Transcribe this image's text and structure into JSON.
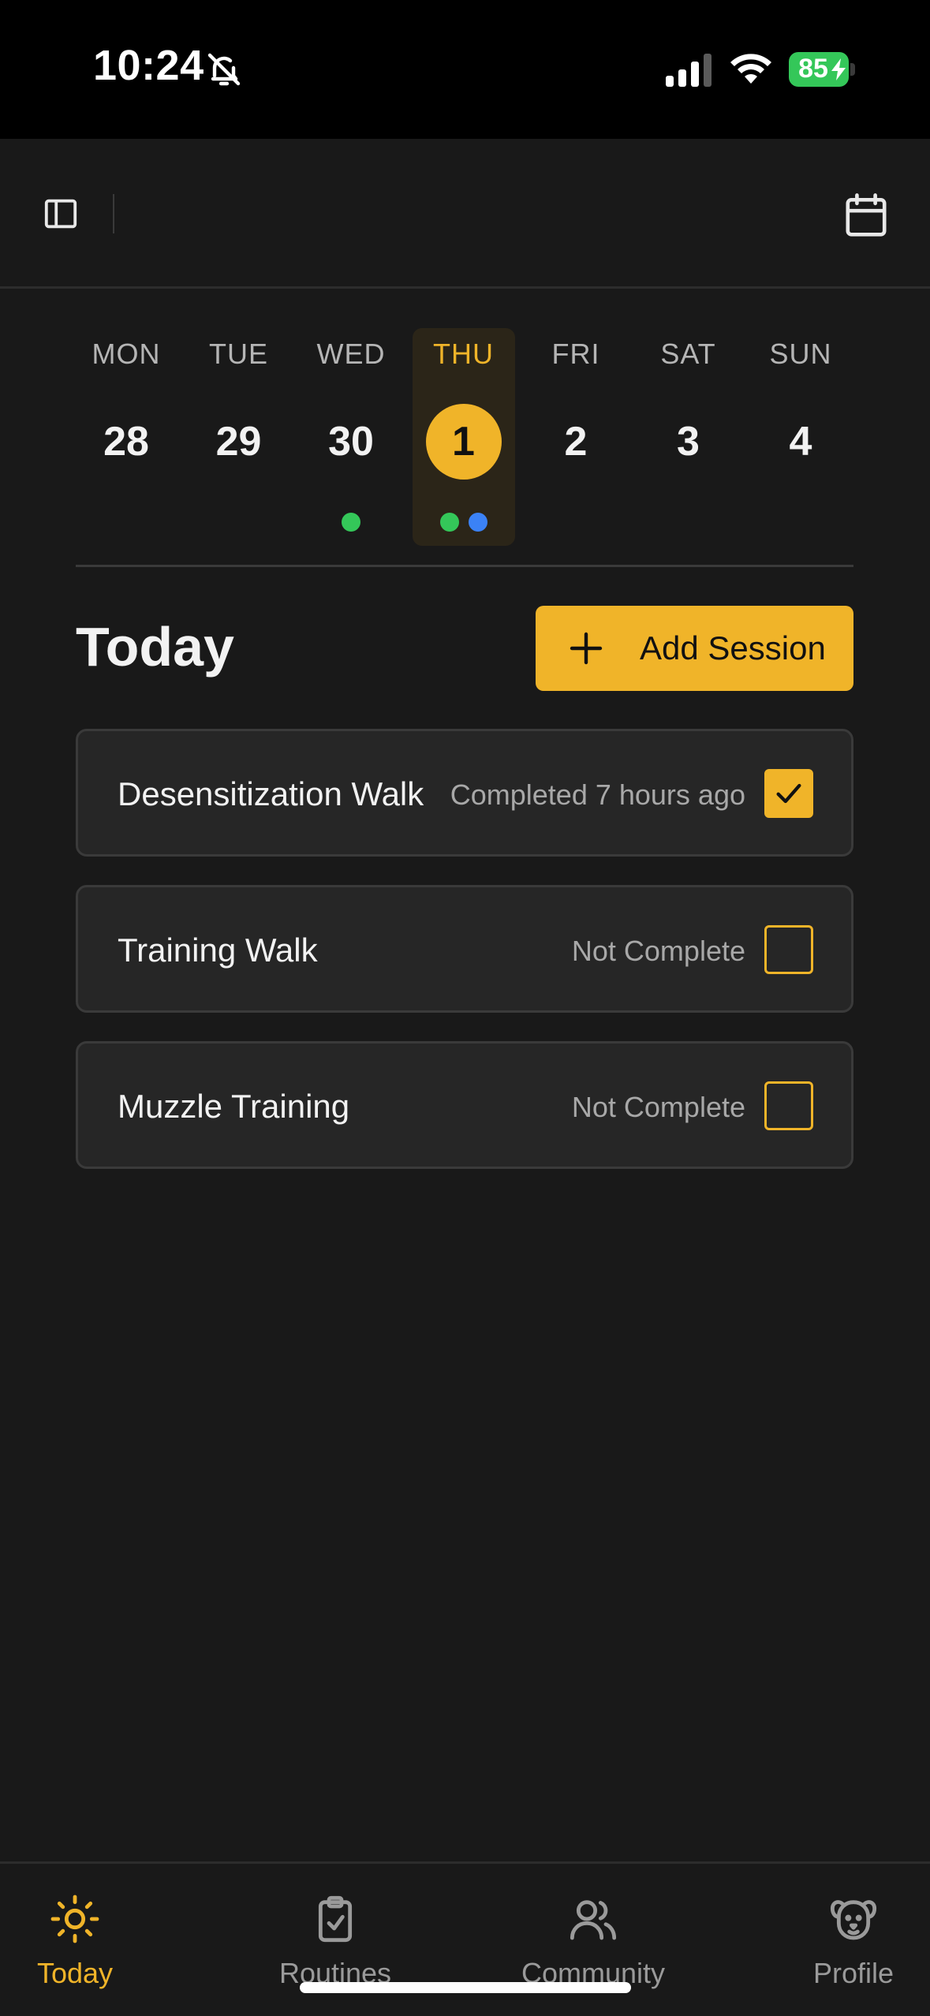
{
  "status_bar": {
    "time": "10:24",
    "battery": "85",
    "icons": [
      "bell-slash-icon",
      "signal-icon",
      "wifi-icon",
      "battery-charging-icon"
    ]
  },
  "top_nav": {
    "icons": [
      "sidebar-toggle-icon",
      "calendar-icon"
    ]
  },
  "week": [
    {
      "name": "MON",
      "num": "28",
      "dots": []
    },
    {
      "name": "TUE",
      "num": "29",
      "dots": []
    },
    {
      "name": "WED",
      "num": "30",
      "dots": [
        "#34c759"
      ]
    },
    {
      "name": "THU",
      "num": "1",
      "dots": [
        "#34c759",
        "#3b82f6"
      ],
      "selected": true
    },
    {
      "name": "FRI",
      "num": "2",
      "dots": []
    },
    {
      "name": "SAT",
      "num": "3",
      "dots": []
    },
    {
      "name": "SUN",
      "num": "4",
      "dots": []
    }
  ],
  "today": {
    "title": "Today",
    "add_session_label": "Add Session"
  },
  "sessions": [
    {
      "name": "Desensitization Walk",
      "status": "Completed 7 hours ago",
      "checked": true
    },
    {
      "name": "Training Walk",
      "status": "Not Complete",
      "checked": false
    },
    {
      "name": "Muzzle Training",
      "status": "Not Complete",
      "checked": false
    }
  ],
  "tabs": [
    {
      "label": "Today",
      "icon": "sun-icon",
      "active": true
    },
    {
      "label": "Routines",
      "icon": "clipboard-check-icon",
      "active": false
    },
    {
      "label": "Community",
      "icon": "users-icon",
      "active": false
    },
    {
      "label": "Profile",
      "icon": "dog-face-icon",
      "active": false
    }
  ],
  "colors": {
    "accent": "#f0b429",
    "background": "#191919",
    "card": "#262626",
    "dot_green": "#34c759",
    "dot_blue": "#3b82f6"
  }
}
